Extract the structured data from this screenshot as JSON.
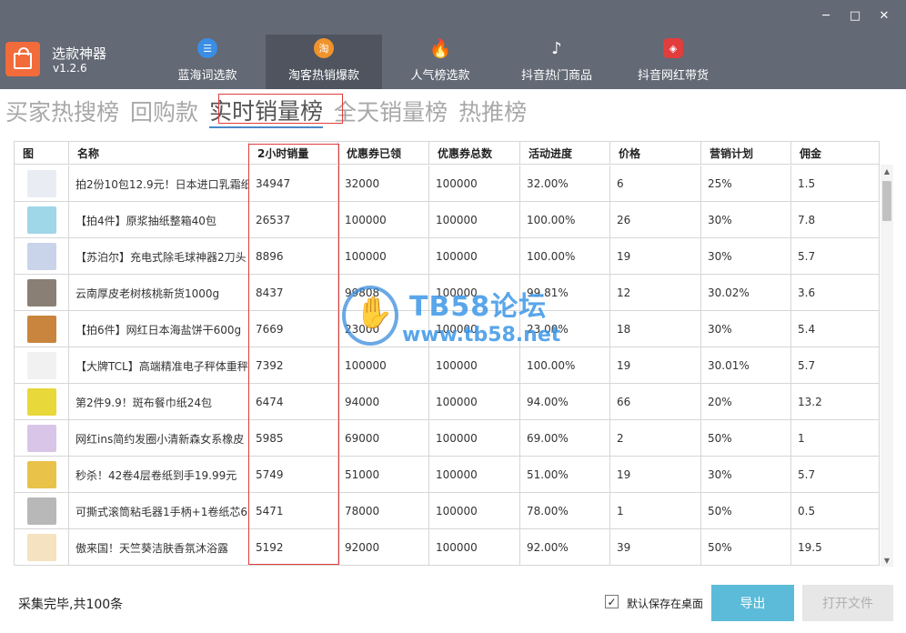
{
  "window": {
    "minimize": "─",
    "maximize": "□",
    "close": "✕"
  },
  "app": {
    "name": "选款神器",
    "version": "v1.2.6"
  },
  "nav": [
    {
      "label": "蓝海词选款",
      "icon": "list-icon",
      "glyph": "☰"
    },
    {
      "label": "淘客热销爆款",
      "icon": "chat-bubble-icon",
      "glyph": "淘"
    },
    {
      "label": "人气榜选款",
      "icon": "flame-icon",
      "glyph": "🔥"
    },
    {
      "label": "抖音热门商品",
      "icon": "tiktok-icon",
      "glyph": "♪"
    },
    {
      "label": "抖音网红带货",
      "icon": "red-bag-icon",
      "glyph": "◈"
    }
  ],
  "subtabs": [
    "买家热搜榜",
    "回购款",
    "实时销量榜",
    "全天销量榜",
    "热推榜"
  ],
  "table": {
    "headers": [
      "图",
      "名称",
      "2小时销量",
      "优惠券已领",
      "优惠券总数",
      "活动进度",
      "价格",
      "营销计划",
      "佣金"
    ],
    "rows": [
      {
        "name": "拍2份10包12.9元！日本进口乳霜纸",
        "sales": "34947",
        "claimed": "32000",
        "total": "100000",
        "progress": "32.00%",
        "price": "6",
        "plan": "25%",
        "commission": "1.5",
        "thumb": "#e9edf3"
      },
      {
        "name": "【拍4件】原浆抽纸整箱40包",
        "sales": "26537",
        "claimed": "100000",
        "total": "100000",
        "progress": "100.00%",
        "price": "26",
        "plan": "30%",
        "commission": "7.8",
        "thumb": "#9fd6e8"
      },
      {
        "name": "【苏泊尔】充电式除毛球神器2刀头",
        "sales": "8896",
        "claimed": "100000",
        "total": "100000",
        "progress": "100.00%",
        "price": "19",
        "plan": "30%",
        "commission": "5.7",
        "thumb": "#c9d4ea"
      },
      {
        "name": "云南厚皮老树核桃新货1000g",
        "sales": "8437",
        "claimed": "99808",
        "total": "100000",
        "progress": "99.81%",
        "price": "12",
        "plan": "30.02%",
        "commission": "3.6",
        "thumb": "#8a7f74"
      },
      {
        "name": "【拍6件】网红日本海盐饼干600g",
        "sales": "7669",
        "claimed": "23000",
        "total": "100000",
        "progress": "23.00%",
        "price": "18",
        "plan": "30%",
        "commission": "5.4",
        "thumb": "#c9853d"
      },
      {
        "name": "【大牌TCL】高端精准电子秤体重秤",
        "sales": "7392",
        "claimed": "100000",
        "total": "100000",
        "progress": "100.00%",
        "price": "19",
        "plan": "30.01%",
        "commission": "5.7",
        "thumb": "#f1f1f1"
      },
      {
        "name": "第2件9.9！斑布餐巾纸24包",
        "sales": "6474",
        "claimed": "94000",
        "total": "100000",
        "progress": "94.00%",
        "price": "66",
        "plan": "20%",
        "commission": "13.2",
        "thumb": "#e8d83a"
      },
      {
        "name": "网红ins简约发圈小清新森女系橡皮",
        "sales": "5985",
        "claimed": "69000",
        "total": "100000",
        "progress": "69.00%",
        "price": "2",
        "plan": "50%",
        "commission": "1",
        "thumb": "#d8c5e8"
      },
      {
        "name": "秒杀！42卷4层卷纸到手19.99元",
        "sales": "5749",
        "claimed": "51000",
        "total": "100000",
        "progress": "51.00%",
        "price": "19",
        "plan": "30%",
        "commission": "5.7",
        "thumb": "#e9c24a"
      },
      {
        "name": "可撕式滚筒粘毛器1手柄+1卷纸芯6",
        "sales": "5471",
        "claimed": "78000",
        "total": "100000",
        "progress": "78.00%",
        "price": "1",
        "plan": "50%",
        "commission": "0.5",
        "thumb": "#b8b8b8"
      },
      {
        "name": "傲来国！天竺葵洁肤香氛沐浴露",
        "sales": "5192",
        "claimed": "92000",
        "total": "100000",
        "progress": "92.00%",
        "price": "39",
        "plan": "50%",
        "commission": "19.5",
        "thumb": "#f4e2c0"
      }
    ]
  },
  "watermark": {
    "line1": "TB58论坛",
    "line2": "www.tb58.net"
  },
  "footer": {
    "status": "采集完毕,共100条",
    "checkbox_label": "默认保存在桌面",
    "checkbox_checked": true,
    "export_label": "导出",
    "open_label": "打开文件"
  },
  "colors": {
    "topbar": "#636975",
    "active_nav": "#4f545f",
    "logo": "#f26b3a",
    "highlight": "#e03c3c",
    "export_button": "#5bbbd8"
  }
}
